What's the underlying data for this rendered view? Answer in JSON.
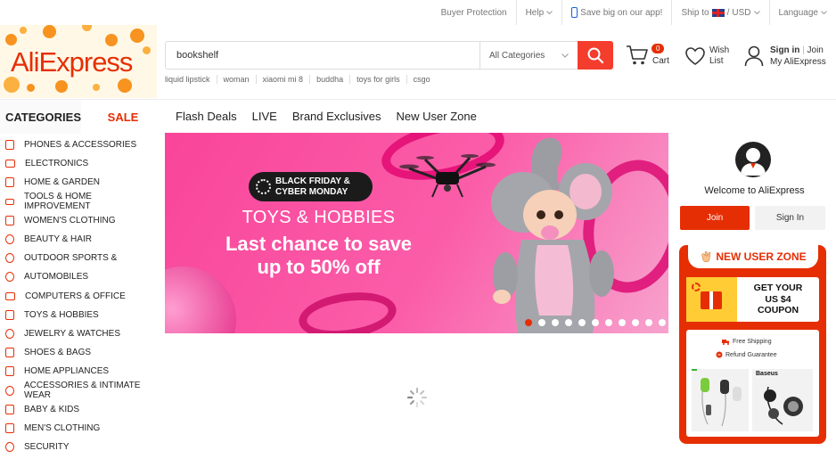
{
  "topbar": {
    "buyer_protection": "Buyer Protection",
    "help": "Help",
    "app": "Save big on our app!",
    "ship_to": "Ship to",
    "currency": "USD",
    "language": "Language"
  },
  "logo": {
    "text": "AliExpress"
  },
  "search": {
    "value": "bookshelf",
    "category": "All Categories",
    "suggestions": [
      "liquid lipstick",
      "woman",
      "xiaomi mi 8",
      "buddha",
      "toys for girls",
      "csgo"
    ]
  },
  "header": {
    "cart_count": "0",
    "cart_label": "Cart",
    "wish_line1": "Wish",
    "wish_line2": "List",
    "sign_in": "Sign in",
    "join": "Join",
    "my_aliexpress": "My AliExpress"
  },
  "nav": {
    "categories": "CATEGORIES",
    "sale": "SALE",
    "links": [
      "Flash Deals",
      "LIVE",
      "Brand Exclusives",
      "New User Zone"
    ]
  },
  "categories": [
    "PHONES & ACCESSORIES",
    "ELECTRONICS",
    "HOME & GARDEN",
    "TOOLS & HOME IMPROVEMENT",
    "WOMEN'S CLOTHING",
    "BEAUTY & HAIR",
    "OUTDOOR SPORTS &",
    "AUTOMOBILES",
    "COMPUTERS & OFFICE",
    "TOYS & HOBBIES",
    "JEWELRY & WATCHES",
    "SHOES & BAGS",
    "HOME APPLIANCES",
    "ACCESSORIES & INTIMATE WEAR",
    "BABY & KIDS",
    "MEN'S CLOTHING",
    "SECURITY"
  ],
  "banner": {
    "badge_line1": "BLACK FRIDAY &",
    "badge_line2": "CYBER MONDAY",
    "title": "TOYS & HOBBIES",
    "line1": "Last chance to save",
    "line2": "up to 50% off",
    "slide_count": 11,
    "active_slide": 1
  },
  "user_panel": {
    "welcome": "Welcome to AliExpress",
    "join": "Join",
    "sign_in": "Sign In"
  },
  "new_user_zone": {
    "title": "NEW USER ZONE",
    "coupon_line1": "GET YOUR",
    "coupon_line2": "US $4",
    "coupon_line3": "COUPON",
    "free_shipping": "Free Shipping",
    "refund": "Refund Guarantee",
    "brand": "Baseus"
  },
  "colors": {
    "brand": "#e62e04",
    "search_button": "#f53d2d",
    "banner": "#f9459a"
  }
}
